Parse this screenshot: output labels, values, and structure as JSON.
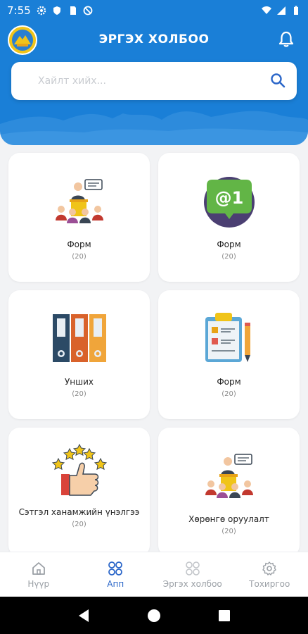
{
  "status_bar": {
    "time": "7:55"
  },
  "header": {
    "title": "ЭРГЭХ ХОЛБОО"
  },
  "search": {
    "placeholder": "Хайлт хийх..."
  },
  "cards": [
    {
      "title": "Форм",
      "count": "(20)",
      "icon": "presentation-icon"
    },
    {
      "title": "Форм",
      "count": "(20)",
      "icon": "mail-chat-icon"
    },
    {
      "title": "Унших",
      "count": "(20)",
      "icon": "binders-icon"
    },
    {
      "title": "Форм",
      "count": "(20)",
      "icon": "clipboard-icon"
    },
    {
      "title": "Сэтгэл ханамжийн үнэлгээ",
      "count": "(20)",
      "icon": "thumbs-up-stars-icon"
    },
    {
      "title": "Хөрөнгө оруулалт",
      "count": "(20)",
      "icon": "presentation-icon"
    }
  ],
  "nav": [
    {
      "label": "Нүүр",
      "icon": "home-icon"
    },
    {
      "label": "Апп",
      "icon": "apps-icon",
      "active": true
    },
    {
      "label": "Эргэх холбоо",
      "icon": "apps-icon"
    },
    {
      "label": "Тохиргоо",
      "icon": "gear-icon"
    }
  ],
  "colors": {
    "primary": "#1a7fd7",
    "active_nav": "#2c67c9",
    "inactive_nav": "#9ba0a6"
  }
}
